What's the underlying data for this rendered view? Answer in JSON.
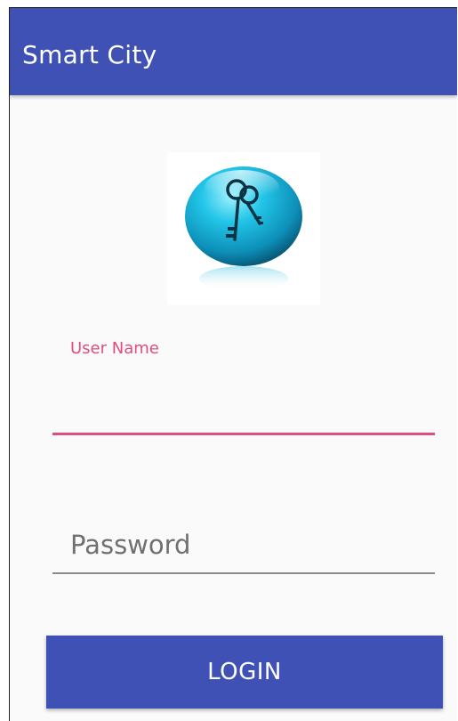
{
  "app_bar": {
    "title": "Smart City",
    "color": "#3f51b5"
  },
  "logo": {
    "icon": "key-icon",
    "color": "#1fb2d6"
  },
  "form": {
    "username_label": "User Name",
    "username_value": "",
    "password_placeholder": "Password",
    "password_value": "",
    "accent_color": "#e04e80"
  },
  "login_button": {
    "label": "LOGIN"
  }
}
